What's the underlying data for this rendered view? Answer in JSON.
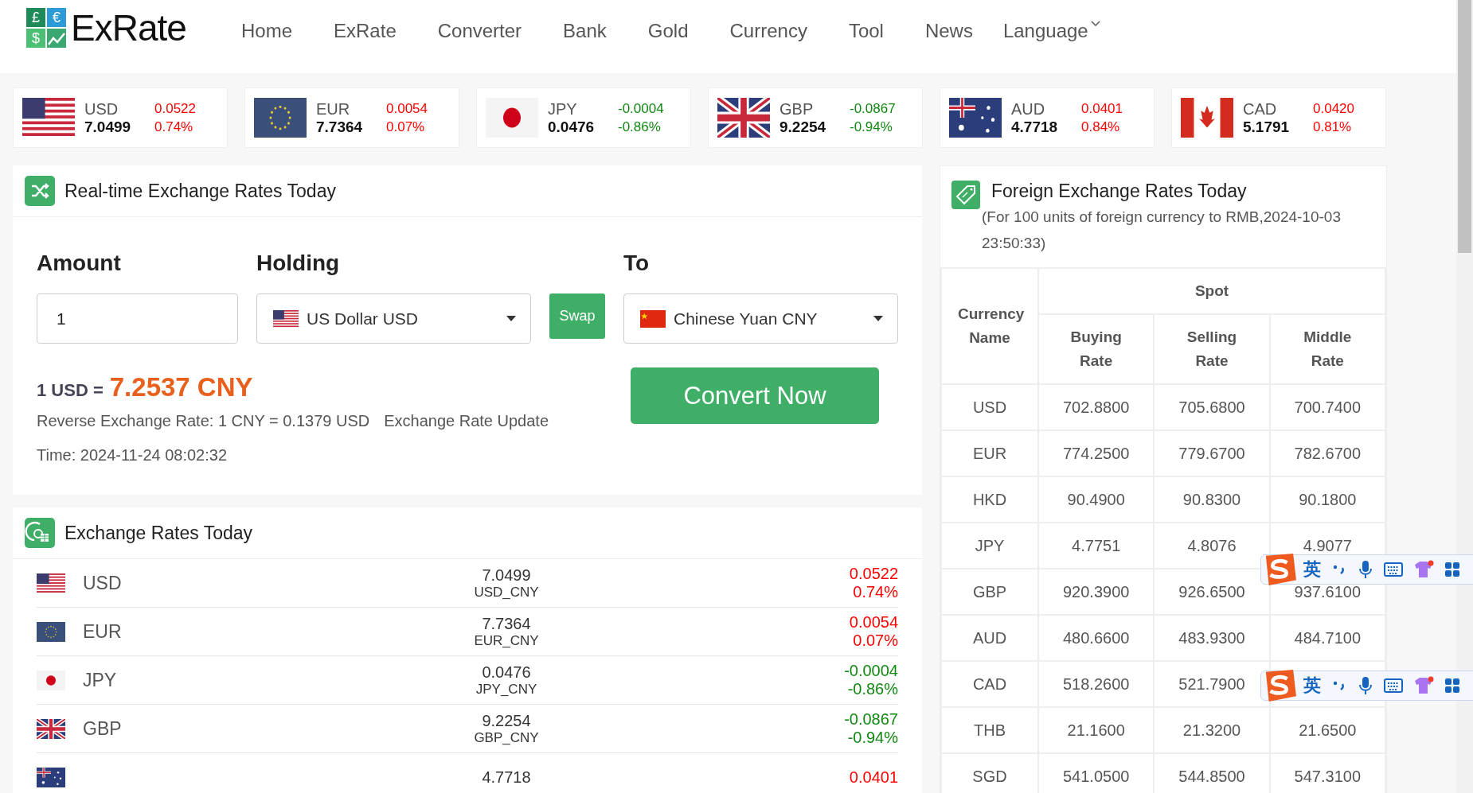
{
  "header": {
    "logo_symbols": [
      "£",
      "€",
      "$"
    ],
    "logo_text": "ExRate",
    "nav": [
      {
        "label": "Home",
        "selected": false
      },
      {
        "label": "ExRate",
        "selected": false
      },
      {
        "label": "Converter",
        "selected": false
      },
      {
        "label": "Bank",
        "selected": false
      },
      {
        "label": "Gold",
        "selected": false
      },
      {
        "label": "Currency",
        "selected": false
      },
      {
        "label": "Tool",
        "selected": false
      },
      {
        "label": "News",
        "selected": false
      }
    ],
    "language": "Language"
  },
  "ticker": [
    {
      "kind": "us",
      "code": "USD",
      "value": "7.0499",
      "change": "0.0522",
      "percent": "0.74%",
      "color": "#ff0000"
    },
    {
      "kind": "eu",
      "code": "EUR",
      "value": "7.7364",
      "change": "0.0054",
      "percent": "0.07%",
      "color": "#ff0000"
    },
    {
      "kind": "jp",
      "code": "JPY",
      "value": "0.0476",
      "change": "-0.0004",
      "percent": "-0.86%",
      "color": "#118811"
    },
    {
      "kind": "gb",
      "code": "GBP",
      "value": "9.2254",
      "change": "-0.0867",
      "percent": "-0.94%",
      "color": "#118811"
    },
    {
      "kind": "au",
      "code": "AUD",
      "value": "4.7718",
      "change": "0.0401",
      "percent": "0.84%",
      "color": "#ff0000"
    },
    {
      "kind": "ca",
      "code": "CAD",
      "value": "5.1791",
      "change": "0.0420",
      "percent": "0.81%",
      "color": "#ff0000"
    }
  ],
  "converter": {
    "title": "Real-time Exchange Rates Today",
    "amount_label": "Amount",
    "amount_value": "1",
    "holding_label": "Holding",
    "holding": {
      "kind": "us",
      "label": "US Dollar USD"
    },
    "swap": "Swap",
    "to_label": "To",
    "to": {
      "kind": "cn",
      "label": "Chinese Yuan CNY"
    },
    "result_prefix": "1 USD =",
    "result_value": "7.2537 CNY",
    "reverse": "Reverse Exchange Rate: 1 CNY = 0.1379 USD",
    "update": "Exchange Rate Update",
    "time": "Time: 2024-11-24 08:02:32",
    "convert_button": "Convert Now"
  },
  "rates_today": {
    "title": "Exchange Rates Today",
    "rows": [
      {
        "kind": "us",
        "code": "USD",
        "value": "7.0499",
        "pair": "USD_CNY",
        "change": "0.0522",
        "percent": "0.74%",
        "color": "#ff0000"
      },
      {
        "kind": "eu",
        "code": "EUR",
        "value": "7.7364",
        "pair": "EUR_CNY",
        "change": "0.0054",
        "percent": "0.07%",
        "color": "#ff0000"
      },
      {
        "kind": "jp",
        "code": "JPY",
        "value": "0.0476",
        "pair": "JPY_CNY",
        "change": "-0.0004",
        "percent": "-0.86%",
        "color": "#118811"
      },
      {
        "kind": "gb",
        "code": "GBP",
        "value": "9.2254",
        "pair": "GBP_CNY",
        "change": "-0.0867",
        "percent": "-0.94%",
        "color": "#118811"
      },
      {
        "kind": "au",
        "value": "4.7718",
        "change": "0.0401",
        "color": "#ff0000"
      }
    ]
  },
  "foreign_rates": {
    "title": "Foreign Exchange Rates Today",
    "subtitle": "(For 100 units of foreign currency to RMB,2024-10-03 23:50:33)",
    "columns": {
      "name": "Currency Name",
      "group": "Spot",
      "buying": "Buying Rate",
      "selling": "Selling Rate",
      "middle": "Middle Rate"
    },
    "rows": [
      {
        "name": "USD",
        "buying": "702.8800",
        "selling": "705.6800",
        "middle": "700.7400"
      },
      {
        "name": "EUR",
        "buying": "774.2500",
        "selling": "779.6700",
        "middle": "782.6700"
      },
      {
        "name": "HKD",
        "buying": "90.4900",
        "selling": "90.8300",
        "middle": "90.1800"
      },
      {
        "name": "JPY",
        "buying": "4.7751",
        "selling": "4.8076",
        "middle": "4.9077"
      },
      {
        "name": "GBP",
        "buying": "920.3900",
        "selling": "926.6500",
        "middle": "937.6100"
      },
      {
        "name": "AUD",
        "buying": "480.6600",
        "selling": "483.9300",
        "middle": "484.7100"
      },
      {
        "name": "CAD",
        "buying": "518.2600",
        "selling": "521.7900"
      },
      {
        "name": "THB",
        "buying": "21.1600",
        "selling": "21.3200",
        "middle": "21.6500"
      },
      {
        "name": "SGD",
        "buying": "541.0500",
        "selling": "544.8500",
        "middle": "547.3100"
      }
    ]
  },
  "ime_toolbars": [
    {
      "mode": "英"
    },
    {
      "mode": "英"
    }
  ]
}
